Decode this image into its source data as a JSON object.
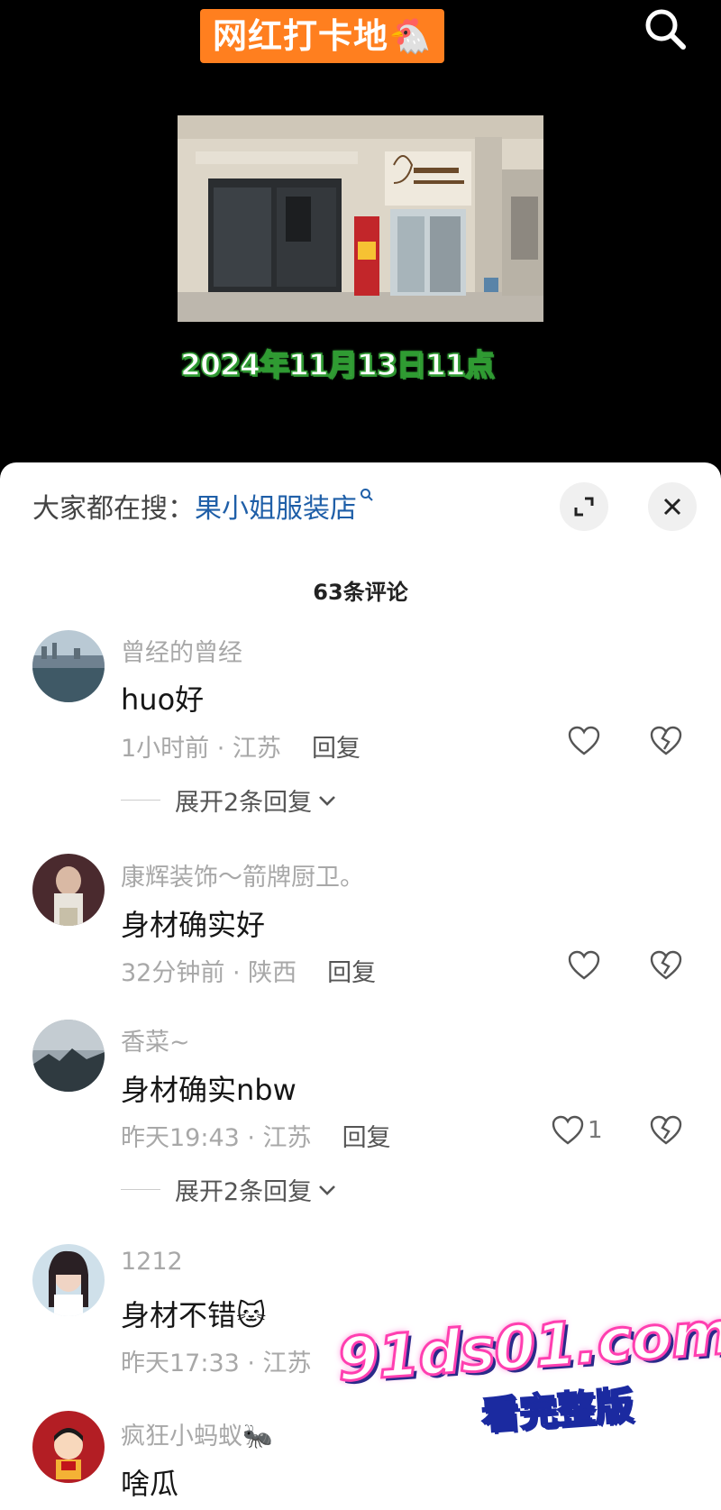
{
  "video": {
    "tag": "网红打卡地🐔",
    "date_caption": "2024年11月13日11点"
  },
  "sheet": {
    "search_prefix": "大家都在搜：",
    "search_term": "果小姐服装店",
    "comment_count": "63条评论"
  },
  "comments": [
    {
      "author": "曾经的曾经",
      "text": "huo好",
      "meta": "1小时前 · 江苏",
      "reply": "回复",
      "likes": "",
      "expand": "展开2条回复"
    },
    {
      "author": "康辉装饰～箭牌厨卫。",
      "text": "身材确实好",
      "meta": "32分钟前 · 陕西",
      "reply": "回复",
      "likes": "",
      "expand": ""
    },
    {
      "author": "香菜~",
      "text": "身材确实nbw",
      "meta": "昨天19:43 · 江苏",
      "reply": "回复",
      "likes": "1",
      "expand": "展开2条回复"
    },
    {
      "author": "1212",
      "text": "身材不错🐱",
      "meta": "昨天17:33 · 江苏",
      "reply": "",
      "likes": "",
      "expand": ""
    },
    {
      "author": "疯狂小蚂蚁🐜",
      "text": "啥瓜",
      "meta": "",
      "reply": "",
      "likes": "",
      "expand": ""
    }
  ],
  "watermark": {
    "domain": "91ds01.com",
    "subtitle": "看完整版"
  },
  "icons": {
    "search": "search-icon",
    "expand": "expand-icon",
    "close": "close-icon",
    "like": "heart-icon",
    "dislike": "broken-heart-icon",
    "chevron": "chevron-down-icon"
  },
  "colors": {
    "tag_bg": "#ff7f1f",
    "search_term": "#1f5fa8",
    "caption_stroke": "#2f9b32",
    "watermark_pink": "#ff3fb0"
  }
}
